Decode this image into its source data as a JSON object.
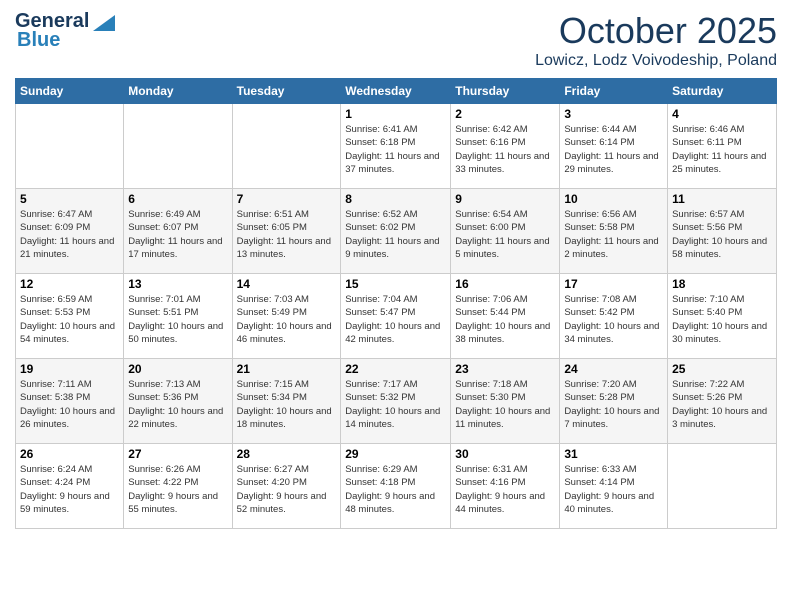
{
  "header": {
    "logo_general": "General",
    "logo_blue": "Blue",
    "month_title": "October 2025",
    "location": "Lowicz, Lodz Voivodeship, Poland"
  },
  "days_of_week": [
    "Sunday",
    "Monday",
    "Tuesday",
    "Wednesday",
    "Thursday",
    "Friday",
    "Saturday"
  ],
  "weeks": [
    [
      {
        "num": "",
        "info": ""
      },
      {
        "num": "",
        "info": ""
      },
      {
        "num": "",
        "info": ""
      },
      {
        "num": "1",
        "info": "Sunrise: 6:41 AM\nSunset: 6:18 PM\nDaylight: 11 hours and 37 minutes."
      },
      {
        "num": "2",
        "info": "Sunrise: 6:42 AM\nSunset: 6:16 PM\nDaylight: 11 hours and 33 minutes."
      },
      {
        "num": "3",
        "info": "Sunrise: 6:44 AM\nSunset: 6:14 PM\nDaylight: 11 hours and 29 minutes."
      },
      {
        "num": "4",
        "info": "Sunrise: 6:46 AM\nSunset: 6:11 PM\nDaylight: 11 hours and 25 minutes."
      }
    ],
    [
      {
        "num": "5",
        "info": "Sunrise: 6:47 AM\nSunset: 6:09 PM\nDaylight: 11 hours and 21 minutes."
      },
      {
        "num": "6",
        "info": "Sunrise: 6:49 AM\nSunset: 6:07 PM\nDaylight: 11 hours and 17 minutes."
      },
      {
        "num": "7",
        "info": "Sunrise: 6:51 AM\nSunset: 6:05 PM\nDaylight: 11 hours and 13 minutes."
      },
      {
        "num": "8",
        "info": "Sunrise: 6:52 AM\nSunset: 6:02 PM\nDaylight: 11 hours and 9 minutes."
      },
      {
        "num": "9",
        "info": "Sunrise: 6:54 AM\nSunset: 6:00 PM\nDaylight: 11 hours and 5 minutes."
      },
      {
        "num": "10",
        "info": "Sunrise: 6:56 AM\nSunset: 5:58 PM\nDaylight: 11 hours and 2 minutes."
      },
      {
        "num": "11",
        "info": "Sunrise: 6:57 AM\nSunset: 5:56 PM\nDaylight: 10 hours and 58 minutes."
      }
    ],
    [
      {
        "num": "12",
        "info": "Sunrise: 6:59 AM\nSunset: 5:53 PM\nDaylight: 10 hours and 54 minutes."
      },
      {
        "num": "13",
        "info": "Sunrise: 7:01 AM\nSunset: 5:51 PM\nDaylight: 10 hours and 50 minutes."
      },
      {
        "num": "14",
        "info": "Sunrise: 7:03 AM\nSunset: 5:49 PM\nDaylight: 10 hours and 46 minutes."
      },
      {
        "num": "15",
        "info": "Sunrise: 7:04 AM\nSunset: 5:47 PM\nDaylight: 10 hours and 42 minutes."
      },
      {
        "num": "16",
        "info": "Sunrise: 7:06 AM\nSunset: 5:44 PM\nDaylight: 10 hours and 38 minutes."
      },
      {
        "num": "17",
        "info": "Sunrise: 7:08 AM\nSunset: 5:42 PM\nDaylight: 10 hours and 34 minutes."
      },
      {
        "num": "18",
        "info": "Sunrise: 7:10 AM\nSunset: 5:40 PM\nDaylight: 10 hours and 30 minutes."
      }
    ],
    [
      {
        "num": "19",
        "info": "Sunrise: 7:11 AM\nSunset: 5:38 PM\nDaylight: 10 hours and 26 minutes."
      },
      {
        "num": "20",
        "info": "Sunrise: 7:13 AM\nSunset: 5:36 PM\nDaylight: 10 hours and 22 minutes."
      },
      {
        "num": "21",
        "info": "Sunrise: 7:15 AM\nSunset: 5:34 PM\nDaylight: 10 hours and 18 minutes."
      },
      {
        "num": "22",
        "info": "Sunrise: 7:17 AM\nSunset: 5:32 PM\nDaylight: 10 hours and 14 minutes."
      },
      {
        "num": "23",
        "info": "Sunrise: 7:18 AM\nSunset: 5:30 PM\nDaylight: 10 hours and 11 minutes."
      },
      {
        "num": "24",
        "info": "Sunrise: 7:20 AM\nSunset: 5:28 PM\nDaylight: 10 hours and 7 minutes."
      },
      {
        "num": "25",
        "info": "Sunrise: 7:22 AM\nSunset: 5:26 PM\nDaylight: 10 hours and 3 minutes."
      }
    ],
    [
      {
        "num": "26",
        "info": "Sunrise: 6:24 AM\nSunset: 4:24 PM\nDaylight: 9 hours and 59 minutes."
      },
      {
        "num": "27",
        "info": "Sunrise: 6:26 AM\nSunset: 4:22 PM\nDaylight: 9 hours and 55 minutes."
      },
      {
        "num": "28",
        "info": "Sunrise: 6:27 AM\nSunset: 4:20 PM\nDaylight: 9 hours and 52 minutes."
      },
      {
        "num": "29",
        "info": "Sunrise: 6:29 AM\nSunset: 4:18 PM\nDaylight: 9 hours and 48 minutes."
      },
      {
        "num": "30",
        "info": "Sunrise: 6:31 AM\nSunset: 4:16 PM\nDaylight: 9 hours and 44 minutes."
      },
      {
        "num": "31",
        "info": "Sunrise: 6:33 AM\nSunset: 4:14 PM\nDaylight: 9 hours and 40 minutes."
      },
      {
        "num": "",
        "info": ""
      }
    ]
  ]
}
